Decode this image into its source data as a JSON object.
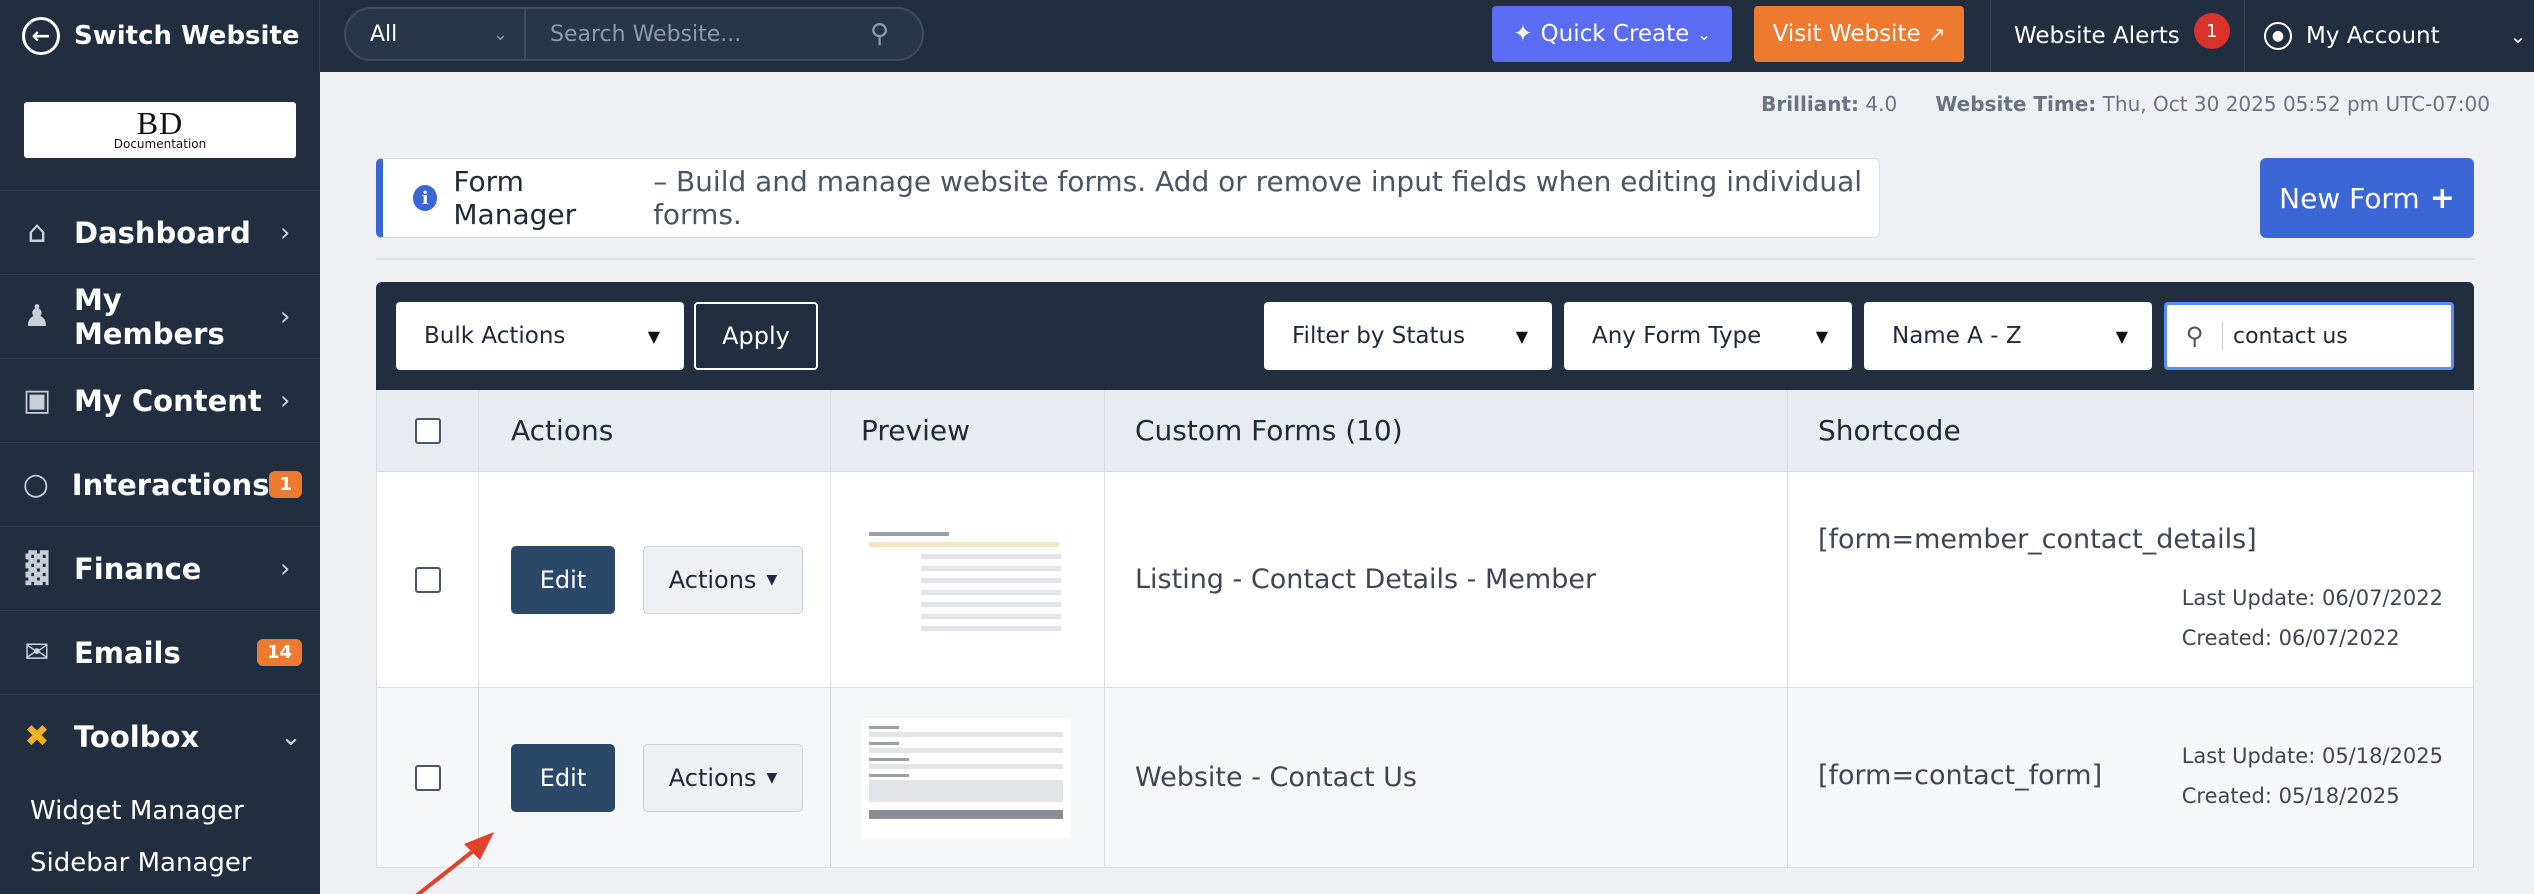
{
  "topbar": {
    "switch_label": "Switch Website",
    "search_scope": "All",
    "search_placeholder": "Search Website...",
    "quick_create": "Quick Create",
    "visit_website": "Visit Website",
    "alerts_label": "Website Alerts",
    "alerts_count": "1",
    "account_label": "My Account"
  },
  "logo": {
    "text": "BD",
    "sub": "Documentation"
  },
  "sidebar": {
    "items": [
      {
        "label": "Dashboard",
        "icon": "home-icon",
        "badge": ""
      },
      {
        "label": "My Members",
        "icon": "members-icon",
        "badge": ""
      },
      {
        "label": "My Content",
        "icon": "folder-icon",
        "badge": ""
      },
      {
        "label": "Interactions",
        "icon": "chat-icon",
        "badge": "1"
      },
      {
        "label": "Finance",
        "icon": "chart-icon",
        "badge": ""
      },
      {
        "label": "Emails",
        "icon": "mail-icon",
        "badge": "14"
      },
      {
        "label": "Toolbox",
        "icon": "tools-icon",
        "badge": ""
      }
    ],
    "subitems": [
      "Widget Manager",
      "Sidebar Manager"
    ]
  },
  "meta": {
    "brilliant_label": "Brilliant:",
    "brilliant_value": "4.0",
    "time_label": "Website Time:",
    "time_value": "Thu, Oct 30 2025 05:52 pm UTC-07:00"
  },
  "info": {
    "title": "Form Manager",
    "text": "– Build and manage website forms. Add or remove input fields when editing individual forms."
  },
  "new_form_label": "New Form",
  "filters": {
    "bulk": "Bulk Actions",
    "apply": "Apply",
    "status": "Filter by Status",
    "type": "Any Form Type",
    "sort": "Name A - Z",
    "search_value": "contact us"
  },
  "table": {
    "headers": {
      "actions": "Actions",
      "preview": "Preview",
      "forms": "Custom Forms (10)",
      "shortcode": "Shortcode"
    },
    "rows": [
      {
        "edit": "Edit",
        "actions": "Actions",
        "name": "Listing - Contact Details - Member",
        "shortcode": "[form=member_contact_details]",
        "updated": "Last Update: 06/07/2022",
        "created": "Created: 06/07/2022"
      },
      {
        "edit": "Edit",
        "actions": "Actions",
        "name": "Website - Contact Us",
        "shortcode": "[form=contact_form]",
        "updated": "Last Update: 05/18/2025",
        "created": "Created: 05/18/2025"
      }
    ]
  },
  "colors": {
    "topbar": "#212e3f",
    "accent_blue": "#3a66d6",
    "quick_create": "#5a6cf2",
    "visit": "#ee7a2f",
    "edit_button": "#2c4868",
    "arrow": "#e0432b"
  }
}
